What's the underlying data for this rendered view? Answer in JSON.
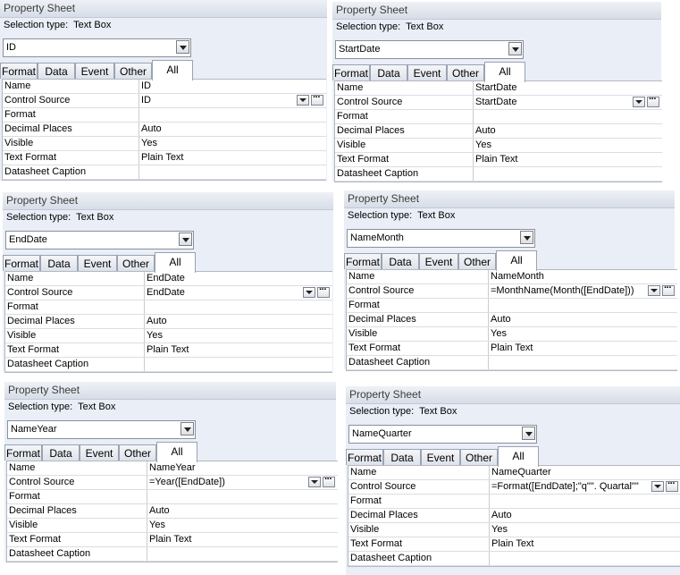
{
  "sheets": [
    {
      "title": "Property Sheet",
      "selection_type_label": "Selection type:",
      "selection_type_value": "Text Box",
      "combo_value": "ID",
      "tabs": [
        "Format",
        "Data",
        "Event",
        "Other",
        "All"
      ],
      "active_tab": "All",
      "properties": [
        {
          "name": "Name",
          "value": "ID"
        },
        {
          "name": "Control Source",
          "value": "ID"
        },
        {
          "name": "Format",
          "value": ""
        },
        {
          "name": "Decimal Places",
          "value": "Auto"
        },
        {
          "name": "Visible",
          "value": "Yes"
        },
        {
          "name": "Text Format",
          "value": "Plain Text"
        },
        {
          "name": "Datasheet Caption",
          "value": ""
        }
      ]
    },
    {
      "title": "Property Sheet",
      "selection_type_label": "Selection type:",
      "selection_type_value": "Text Box",
      "combo_value": "StartDate",
      "tabs": [
        "Format",
        "Data",
        "Event",
        "Other",
        "All"
      ],
      "active_tab": "All",
      "properties": [
        {
          "name": "Name",
          "value": "StartDate"
        },
        {
          "name": "Control Source",
          "value": "StartDate"
        },
        {
          "name": "Format",
          "value": ""
        },
        {
          "name": "Decimal Places",
          "value": "Auto"
        },
        {
          "name": "Visible",
          "value": "Yes"
        },
        {
          "name": "Text Format",
          "value": "Plain Text"
        },
        {
          "name": "Datasheet Caption",
          "value": ""
        }
      ]
    },
    {
      "title": "Property Sheet",
      "selection_type_label": "Selection type:",
      "selection_type_value": "Text Box",
      "combo_value": "EndDate",
      "tabs": [
        "Format",
        "Data",
        "Event",
        "Other",
        "All"
      ],
      "active_tab": "All",
      "properties": [
        {
          "name": "Name",
          "value": "EndDate"
        },
        {
          "name": "Control Source",
          "value": "EndDate"
        },
        {
          "name": "Format",
          "value": ""
        },
        {
          "name": "Decimal Places",
          "value": "Auto"
        },
        {
          "name": "Visible",
          "value": "Yes"
        },
        {
          "name": "Text Format",
          "value": "Plain Text"
        },
        {
          "name": "Datasheet Caption",
          "value": ""
        }
      ]
    },
    {
      "title": "Property Sheet",
      "selection_type_label": "Selection type:",
      "selection_type_value": "Text Box",
      "combo_value": "NameMonth",
      "tabs": [
        "Format",
        "Data",
        "Event",
        "Other",
        "All"
      ],
      "active_tab": "All",
      "properties": [
        {
          "name": "Name",
          "value": "NameMonth"
        },
        {
          "name": "Control Source",
          "value": "=MonthName(Month([EndDate]))"
        },
        {
          "name": "Format",
          "value": ""
        },
        {
          "name": "Decimal Places",
          "value": "Auto"
        },
        {
          "name": "Visible",
          "value": "Yes"
        },
        {
          "name": "Text Format",
          "value": "Plain Text"
        },
        {
          "name": "Datasheet Caption",
          "value": ""
        }
      ]
    },
    {
      "title": "Property Sheet",
      "selection_type_label": "Selection type:",
      "selection_type_value": "Text Box",
      "combo_value": "NameYear",
      "tabs": [
        "Format",
        "Data",
        "Event",
        "Other",
        "All"
      ],
      "active_tab": "All",
      "properties": [
        {
          "name": "Name",
          "value": "NameYear"
        },
        {
          "name": "Control Source",
          "value": "=Year([EndDate])"
        },
        {
          "name": "Format",
          "value": ""
        },
        {
          "name": "Decimal Places",
          "value": "Auto"
        },
        {
          "name": "Visible",
          "value": "Yes"
        },
        {
          "name": "Text Format",
          "value": "Plain Text"
        },
        {
          "name": "Datasheet Caption",
          "value": ""
        }
      ]
    },
    {
      "title": "Property Sheet",
      "selection_type_label": "Selection type:",
      "selection_type_value": "Text Box",
      "combo_value": "NameQuarter",
      "tabs": [
        "Format",
        "Data",
        "Event",
        "Other",
        "All"
      ],
      "active_tab": "All",
      "properties": [
        {
          "name": "Name",
          "value": "NameQuarter"
        },
        {
          "name": "Control Source",
          "value": "=Format([EndDate];\"q\"\". Quartal\"\""
        },
        {
          "name": "Format",
          "value": ""
        },
        {
          "name": "Decimal Places",
          "value": "Auto"
        },
        {
          "name": "Visible",
          "value": "Yes"
        },
        {
          "name": "Text Format",
          "value": "Plain Text"
        },
        {
          "name": "Datasheet Caption",
          "value": ""
        }
      ]
    }
  ]
}
